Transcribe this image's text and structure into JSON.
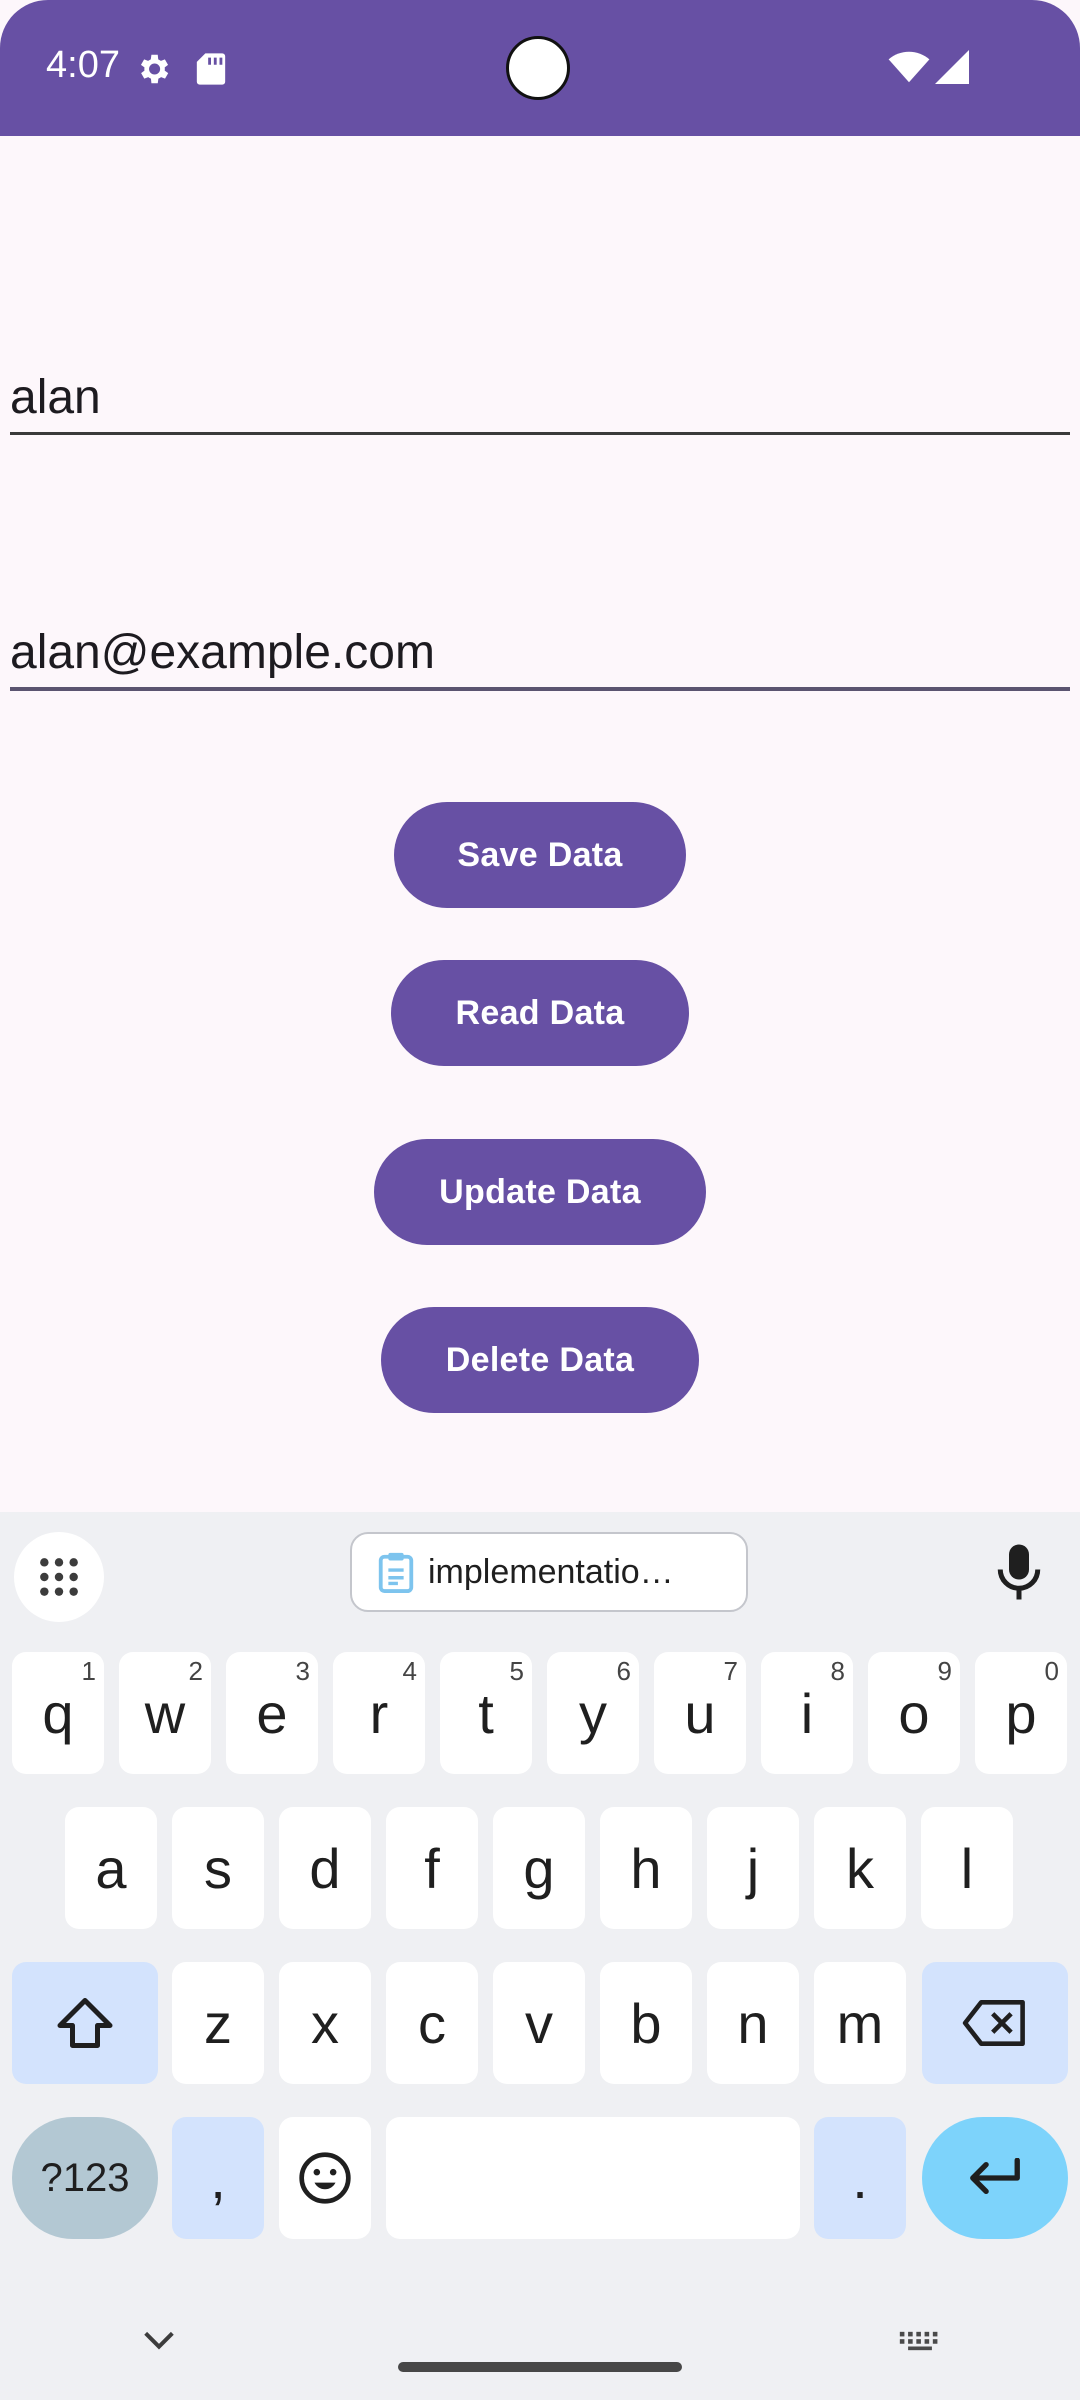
{
  "status": {
    "time": "4:07",
    "colors": {
      "bar": "#6750a4"
    }
  },
  "form": {
    "name_value": "alan",
    "email_value": "alan@example.com"
  },
  "buttons": {
    "save": "Save Data",
    "read": "Read Data",
    "update": "Update Data",
    "delete": "Delete Data"
  },
  "keyboard": {
    "clipboard_suggestion": "implementatio…",
    "row1": [
      {
        "key": "q",
        "hint": "1"
      },
      {
        "key": "w",
        "hint": "2"
      },
      {
        "key": "e",
        "hint": "3"
      },
      {
        "key": "r",
        "hint": "4"
      },
      {
        "key": "t",
        "hint": "5"
      },
      {
        "key": "y",
        "hint": "6"
      },
      {
        "key": "u",
        "hint": "7"
      },
      {
        "key": "i",
        "hint": "8"
      },
      {
        "key": "o",
        "hint": "9"
      },
      {
        "key": "p",
        "hint": "0"
      }
    ],
    "row2": [
      "a",
      "s",
      "d",
      "f",
      "g",
      "h",
      "j",
      "k",
      "l"
    ],
    "row3": [
      "z",
      "x",
      "c",
      "v",
      "b",
      "n",
      "m"
    ],
    "symbols_key": "?123",
    "comma_key": ",",
    "period_key": "."
  }
}
